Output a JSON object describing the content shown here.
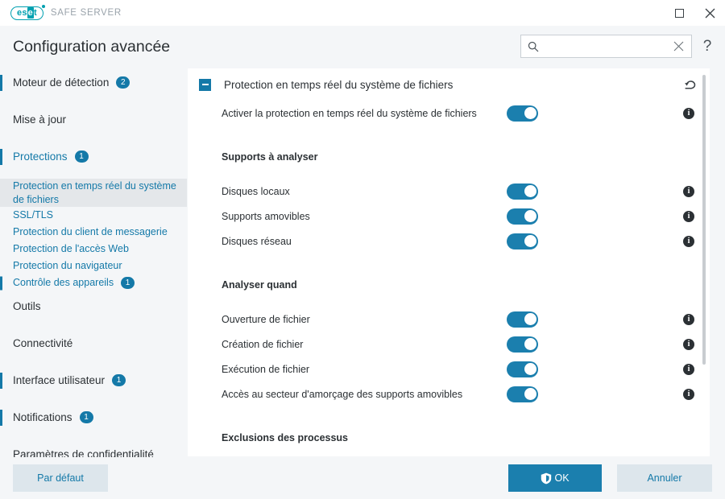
{
  "titlebar": {
    "logo_text_left": "es",
    "logo_text_mid": "e",
    "logo_text_right": "t",
    "product_name": "SAFE SERVER",
    "maximize_label": "",
    "close_label": "✕"
  },
  "header": {
    "title": "Configuration avancée",
    "search_value": "",
    "search_placeholder": "",
    "help_label": "?"
  },
  "sidebar": {
    "items": [
      {
        "label": "Moteur de détection",
        "badge": "2",
        "level": "top",
        "accent": false,
        "bar": true,
        "selected": false
      },
      {
        "label": "Mise à jour",
        "badge": "",
        "level": "top",
        "accent": false,
        "bar": false,
        "selected": false
      },
      {
        "label": "Protections",
        "badge": "1",
        "level": "top",
        "accent": true,
        "bar": true,
        "selected": false
      },
      {
        "label": "Protection en temps réel du système de fichiers",
        "badge": "",
        "level": "sub",
        "accent": true,
        "bar": false,
        "selected": true
      },
      {
        "label": "SSL/TLS",
        "badge": "",
        "level": "sub",
        "accent": true,
        "bar": false,
        "selected": false
      },
      {
        "label": "Protection du client de messagerie",
        "badge": "",
        "level": "sub",
        "accent": true,
        "bar": false,
        "selected": false
      },
      {
        "label": "Protection de l'accès Web",
        "badge": "",
        "level": "sub",
        "accent": true,
        "bar": false,
        "selected": false
      },
      {
        "label": "Protection du navigateur",
        "badge": "",
        "level": "sub",
        "accent": true,
        "bar": false,
        "selected": false
      },
      {
        "label": "Contrôle des appareils",
        "badge": "1",
        "level": "sub",
        "accent": true,
        "bar": true,
        "selected": false
      },
      {
        "label": "Outils",
        "badge": "",
        "level": "top",
        "accent": false,
        "bar": false,
        "selected": false
      },
      {
        "label": "Connectivité",
        "badge": "",
        "level": "top",
        "accent": false,
        "bar": false,
        "selected": false
      },
      {
        "label": "Interface utilisateur",
        "badge": "1",
        "level": "top",
        "accent": false,
        "bar": true,
        "selected": false
      },
      {
        "label": "Notifications",
        "badge": "1",
        "level": "top",
        "accent": false,
        "bar": true,
        "selected": false
      },
      {
        "label": "Paramètres de confidentialité",
        "badge": "",
        "level": "top",
        "accent": false,
        "bar": false,
        "selected": false
      }
    ]
  },
  "content": {
    "section_title": "Protection en temps réel du système de fichiers",
    "rows": [
      {
        "label": "Activer la protection en temps réel du système de fichiers",
        "state": "on"
      }
    ],
    "groups": [
      {
        "label": "Supports à analyser",
        "rows": [
          {
            "label": "Disques locaux",
            "state": "on"
          },
          {
            "label": "Supports amovibles",
            "state": "on"
          },
          {
            "label": "Disques réseau",
            "state": "on"
          }
        ]
      },
      {
        "label": "Analyser quand",
        "rows": [
          {
            "label": "Ouverture de fichier",
            "state": "on"
          },
          {
            "label": "Création de fichier",
            "state": "on"
          },
          {
            "label": "Exécution de fichier",
            "state": "on"
          },
          {
            "label": "Accès au secteur d'amorçage des supports amovibles",
            "state": "on"
          }
        ]
      },
      {
        "label": "Exclusions des processus",
        "rows": []
      }
    ]
  },
  "footer": {
    "default_label": "Par défaut",
    "ok_label": "OK",
    "cancel_label": "Annuler"
  },
  "colors": {
    "accent_blue": "#1479a8",
    "toggle_on": "#1b7fae",
    "brand_teal": "#00a0b0",
    "panel_bg": "#f4f6f8",
    "selected_bg": "#e4e7ea"
  }
}
